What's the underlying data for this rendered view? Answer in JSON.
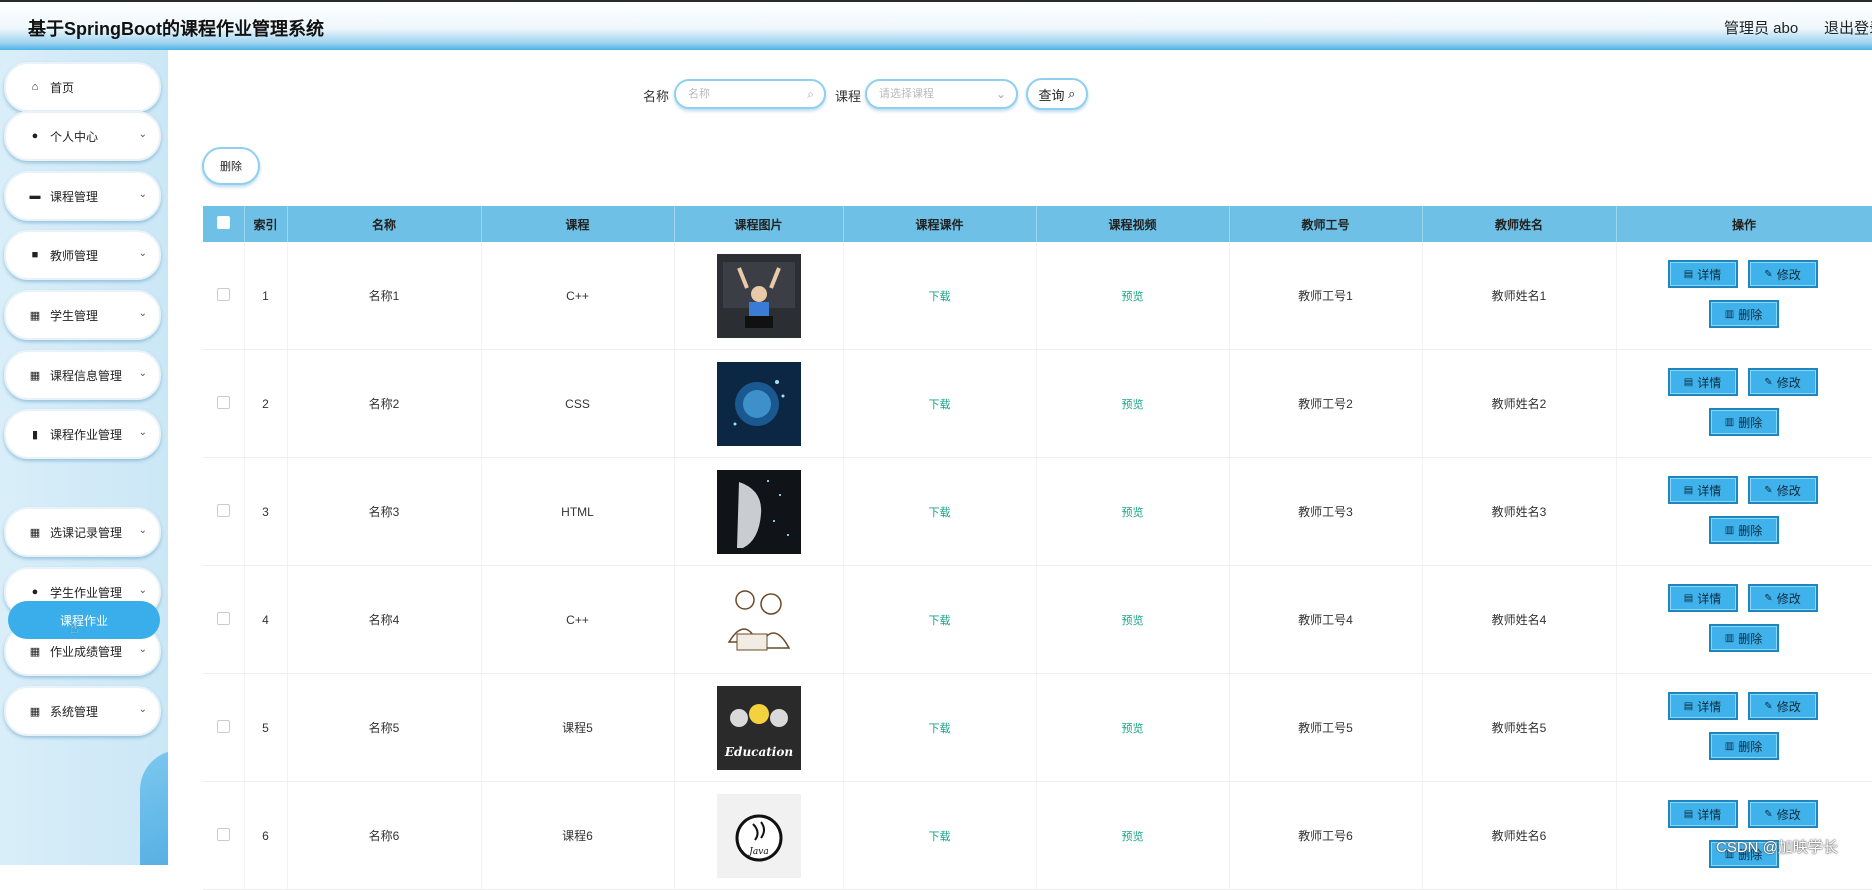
{
  "header": {
    "title": "基于SpringBoot的课程作业管理系统",
    "admin": "管理员 abo",
    "logout": "退出登录"
  },
  "sidebar": {
    "items": [
      {
        "label": "首页",
        "icon": "home-icon",
        "glyph": "⌂",
        "chevron": false
      },
      {
        "label": "个人中心",
        "icon": "user-icon",
        "glyph": "●",
        "chevron": true
      },
      {
        "label": "课程管理",
        "icon": "briefcase-icon",
        "glyph": "▬",
        "chevron": true
      },
      {
        "label": "教师管理",
        "icon": "chat-icon",
        "glyph": "■",
        "chevron": true
      },
      {
        "label": "学生管理",
        "icon": "grid-icon",
        "glyph": "▦",
        "chevron": true
      },
      {
        "label": "课程信息管理",
        "icon": "grid-icon",
        "glyph": "▦",
        "chevron": true
      },
      {
        "label": "课程作业管理",
        "icon": "bar-chart-icon",
        "glyph": "▮",
        "chevron": true
      },
      {
        "label": "选课记录管理",
        "icon": "grid-icon",
        "glyph": "▦",
        "chevron": true
      },
      {
        "label": "学生作业管理",
        "icon": "location-pin-icon",
        "glyph": "●",
        "chevron": true
      },
      {
        "label": "作业成绩管理",
        "icon": "apps-icon",
        "glyph": "▦",
        "chevron": true
      },
      {
        "label": "系统管理",
        "icon": "grid-icon",
        "glyph": "▦",
        "chevron": true
      }
    ],
    "active_sub": "课程作业"
  },
  "search": {
    "name_label": "名称",
    "name_placeholder": "名称",
    "course_label": "课程",
    "course_placeholder": "请选择课程",
    "query_button": "查询"
  },
  "toolbar": {
    "delete_label": "删除"
  },
  "table": {
    "columns": [
      "索引",
      "名称",
      "课程",
      "课程图片",
      "课程课件",
      "课程视频",
      "教师工号",
      "教师姓名",
      "操作"
    ],
    "rows": [
      {
        "index": "1",
        "name": "名称1",
        "course": "C++",
        "image": "students-image",
        "file": "下载",
        "video": "预览",
        "teacher_id": "教师工号1",
        "teacher_name": "教师姓名1"
      },
      {
        "index": "2",
        "name": "名称2",
        "course": "CSS",
        "image": "ai-head-image",
        "file": "下载",
        "video": "预览",
        "teacher_id": "教师工号2",
        "teacher_name": "教师姓名2"
      },
      {
        "index": "3",
        "name": "名称3",
        "course": "HTML",
        "image": "robot-face-image",
        "file": "下载",
        "video": "预览",
        "teacher_id": "教师工号3",
        "teacher_name": "教师姓名3"
      },
      {
        "index": "4",
        "name": "名称4",
        "course": "C++",
        "image": "sketch-people-image",
        "file": "下载",
        "video": "预览",
        "teacher_id": "教师工号4",
        "teacher_name": "教师姓名4"
      },
      {
        "index": "5",
        "name": "名称5",
        "course": "课程5",
        "image": "education-image",
        "file": "下载",
        "video": "预览",
        "teacher_id": "教师工号5",
        "teacher_name": "教师姓名5"
      },
      {
        "index": "6",
        "name": "名称6",
        "course": "课程6",
        "image": "java-logo-image",
        "file": "下载",
        "video": "预览",
        "teacher_id": "教师工号6",
        "teacher_name": "教师姓名6"
      }
    ],
    "actions": {
      "detail": "详情",
      "edit": "修改",
      "delete": "删除"
    }
  },
  "education_text": "Education",
  "java_text": "Java",
  "watermark": "CSDN @加映学长",
  "colors": {
    "accent": "#3aaeea",
    "table_header": "#6ec0e6",
    "link": "#17a589"
  }
}
